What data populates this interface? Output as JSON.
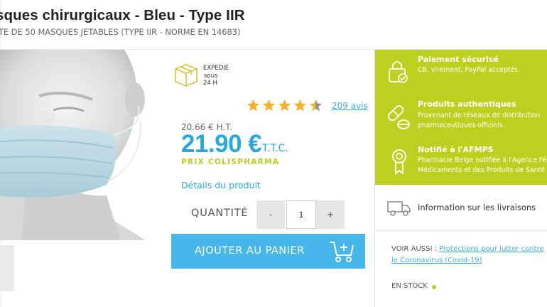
{
  "header": {
    "title": "sques chirurgicaux - Bleu - Type IIR",
    "subtitle": "TE DE 50 MASQUES JETABLES (TYPE IIR - NORME EN 14683)"
  },
  "shipping": {
    "line1": "EXPEDIE",
    "line2": "sous",
    "line3": "24 H",
    "icon": "box-icon"
  },
  "rating": {
    "value": 4.5,
    "max": 5,
    "reviews_label": "209 avis",
    "star_color": "#f2b12e"
  },
  "price": {
    "ht": "20.66 € H.T.",
    "main": "21.90 €",
    "ttc": "T.T.C.",
    "label": "PRIX COLISPHARMA"
  },
  "details_link": "Détails du produit",
  "quantity": {
    "label": "QUANTITÉ",
    "minus": "-",
    "value": "1",
    "plus": "+"
  },
  "cart_button": {
    "label": "AJOUTER AU PANIER",
    "icon": "cart-icon"
  },
  "features": [
    {
      "title": "Paiement sécurisé",
      "line1": "CB, virement, PayPal acceptés.",
      "line2": "",
      "icon": "lock-icon"
    },
    {
      "title": "Produits authentiques",
      "line1": "Provenant de réseaux de distribution",
      "line2": "pharmaceutiques officiels.",
      "icon": "pills-icon"
    },
    {
      "title": "Notifié à l'AFMPS",
      "line1": "Pharmacie Belge notifiée à l'Agence Fédéra",
      "line2": "Médicaments et des Produits de Santé",
      "icon": "award-icon"
    }
  ],
  "delivery": {
    "label": "Information sur les livraisons",
    "icon": "truck-icon"
  },
  "voir_aussi": {
    "prefix": "VOIR AUSSI :",
    "link": "Protections pour lutter contre le Coronavirus (Covid-19)"
  },
  "stock": {
    "label": "EN STOCK",
    "color": "#b5cf1b"
  },
  "colors": {
    "accent_blue": "#29a8e0",
    "accent_green": "#bcd020",
    "button_blue": "#45b7e8"
  }
}
